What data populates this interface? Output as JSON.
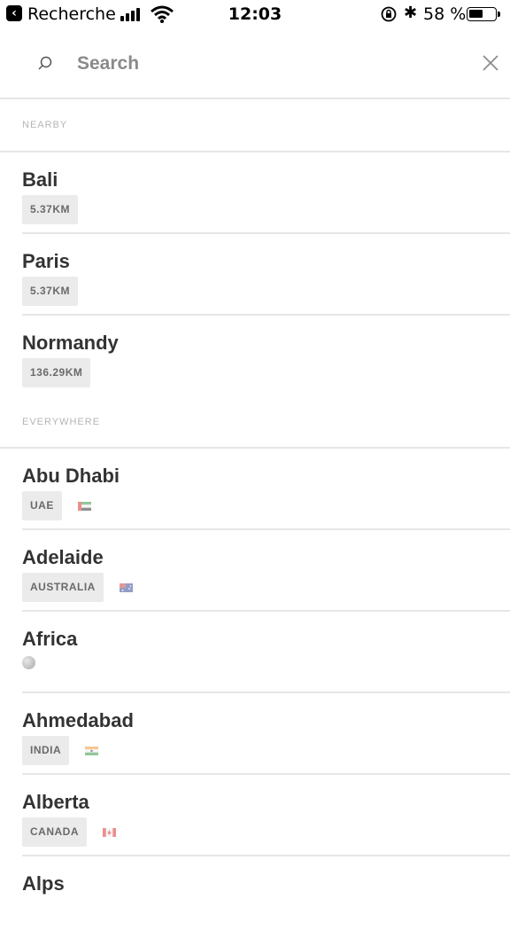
{
  "status_bar": {
    "back_app": "Recherche",
    "time": "12:03",
    "battery_percent": "58 %",
    "battery_level": 0.58
  },
  "search": {
    "placeholder": "Search",
    "search_icon": "search-icon",
    "close_icon": "close-icon"
  },
  "sections": {
    "nearby": {
      "header": "NEARBY",
      "items": [
        {
          "name": "Bali",
          "tag": "5.37KM"
        },
        {
          "name": "Paris",
          "tag": "5.37KM"
        },
        {
          "name": "Normandy",
          "tag": "136.29KM"
        }
      ]
    },
    "everywhere": {
      "header": "EVERYWHERE",
      "items": [
        {
          "name": "Abu Dhabi",
          "tag": "UAE",
          "icon": "uae-flag-icon"
        },
        {
          "name": "Adelaide",
          "tag": "AUSTRALIA",
          "icon": "australia-flag-icon"
        },
        {
          "name": "Africa",
          "icon": "globe-icon"
        },
        {
          "name": "Ahmedabad",
          "tag": "INDIA",
          "icon": "india-flag-icon"
        },
        {
          "name": "Alberta",
          "tag": "CANADA",
          "icon": "canada-flag-icon"
        },
        {
          "name": "Alps"
        }
      ]
    }
  }
}
